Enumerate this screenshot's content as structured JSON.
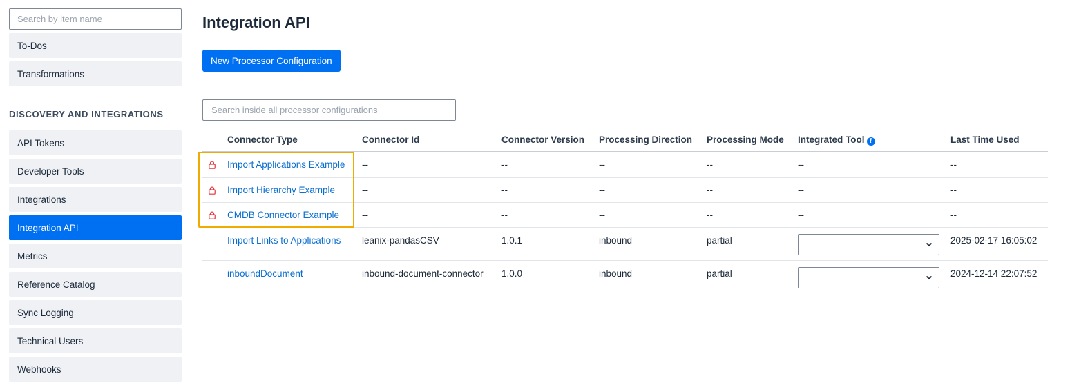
{
  "sidebar": {
    "search_placeholder": "Search by item name",
    "items_top": [
      "To-Dos",
      "Transformations"
    ],
    "section_title": "DISCOVERY AND INTEGRATIONS",
    "items": [
      "API Tokens",
      "Developer Tools",
      "Integrations",
      "Integration API",
      "Metrics",
      "Reference Catalog",
      "Sync Logging",
      "Technical Users",
      "Webhooks"
    ],
    "active_item": "Integration API"
  },
  "main": {
    "title": "Integration API",
    "new_button": "New Processor Configuration",
    "search_placeholder": "Search inside all processor configurations"
  },
  "table": {
    "columns": [
      "Connector Type",
      "Connector Id",
      "Connector Version",
      "Processing Direction",
      "Processing Mode",
      "Integrated Tool",
      "Last Time Used"
    ],
    "integrated_tool_icon": "info-icon",
    "rows": [
      {
        "connector_type": "Import Applications Example",
        "connector_id": "--",
        "version": "--",
        "direction": "--",
        "mode": "--",
        "tool": "--",
        "last_used": "--",
        "locked": true
      },
      {
        "connector_type": "Import Hierarchy Example",
        "connector_id": "--",
        "version": "--",
        "direction": "--",
        "mode": "--",
        "tool": "--",
        "last_used": "--",
        "locked": true
      },
      {
        "connector_type": "CMDB Connector Example",
        "connector_id": "--",
        "version": "--",
        "direction": "--",
        "mode": "--",
        "tool": "--",
        "last_used": "--",
        "locked": true
      },
      {
        "connector_type": "Import Links to Applications",
        "connector_id": "leanix-pandasCSV",
        "version": "1.0.1",
        "direction": "inbound",
        "mode": "partial",
        "tool": "",
        "last_used": "2025-02-17 16:05:02",
        "locked": false
      },
      {
        "connector_type": "inboundDocument",
        "connector_id": "inbound-document-connector",
        "version": "1.0.0",
        "direction": "inbound",
        "mode": "partial",
        "tool": "",
        "last_used": "2024-12-14 22:07:52",
        "locked": false
      }
    ]
  },
  "colors": {
    "primary": "#0070f2",
    "link": "#0a6ed1",
    "lock": "#e5343a",
    "highlight": "#f0ab00",
    "sidebar_bg": "#eff1f5"
  }
}
